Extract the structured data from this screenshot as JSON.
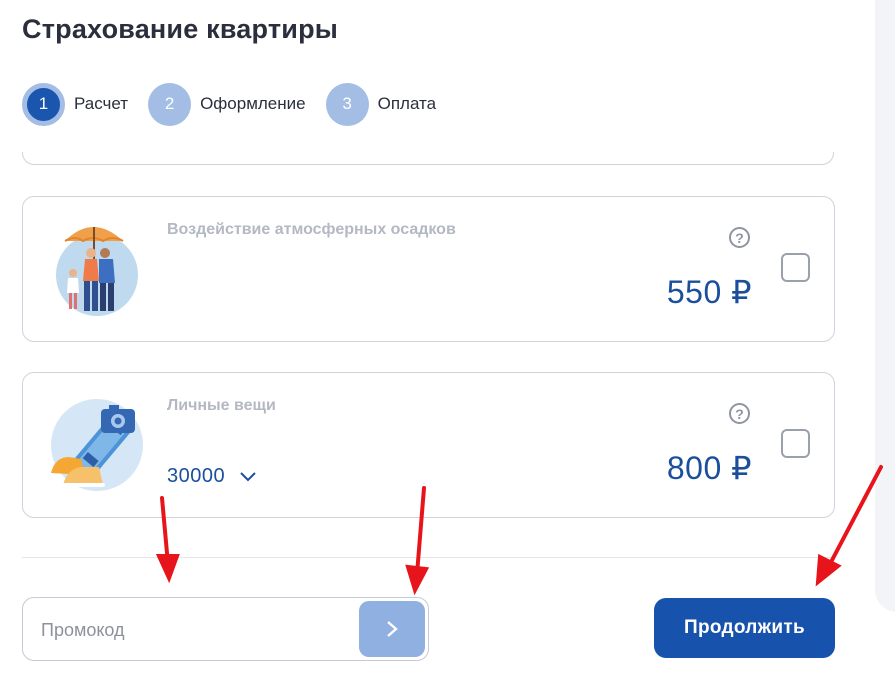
{
  "page": {
    "title": "Страхование квартиры"
  },
  "steps": [
    {
      "number": "1",
      "label": "Расчет",
      "active": true
    },
    {
      "number": "2",
      "label": "Оформление",
      "active": false
    },
    {
      "number": "3",
      "label": "Оплата",
      "active": false
    }
  ],
  "options": [
    {
      "title": "Воздействие атмосферных осадков",
      "help": "?",
      "price": "550 ₽",
      "checked": false,
      "illustration": "family-umbrella-illustration"
    },
    {
      "title": "Личные вещи",
      "help": "?",
      "price": "800 ₽",
      "checked": false,
      "illustration": "personal-items-illustration",
      "sum_selected": "30000"
    }
  ],
  "promo": {
    "placeholder": "Промокод",
    "submit_icon": "chevron-right-icon"
  },
  "actions": {
    "continue_label": "Продолжить"
  },
  "colors": {
    "primary": "#1752ad",
    "step_inactive": "#a3bde4",
    "price": "#1b4f9b",
    "promo_button": "#8fb0e0",
    "annotation_arrow": "#e8141b"
  }
}
